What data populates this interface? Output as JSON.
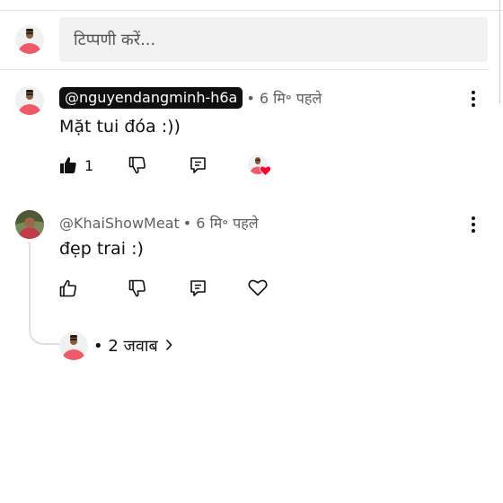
{
  "compose": {
    "placeholder": "टिप्पणी करें..."
  },
  "comments": [
    {
      "handle": "@nguyendangminh-h6a",
      "time": "• 6 मि॰ पहले",
      "text": "Mặt tui đóa :))",
      "like_count": "1",
      "creator_hearted": true
    },
    {
      "handle": "@KhaiShowMeat",
      "time": "• 6 मि॰ पहले",
      "text": "đẹp trai :)",
      "like_count": "",
      "creator_hearted": false
    }
  ],
  "replies": {
    "label": "• 2 जवाब"
  },
  "icons": {
    "like": "thumbs-up-icon",
    "dislike": "thumbs-down-icon",
    "reply": "reply-icon",
    "heart": "heart-icon",
    "more": "more-vert-icon"
  },
  "colors": {
    "heart": "#ff0033",
    "chip": "#0f0f0f",
    "shirt": "#ee5a6a"
  }
}
